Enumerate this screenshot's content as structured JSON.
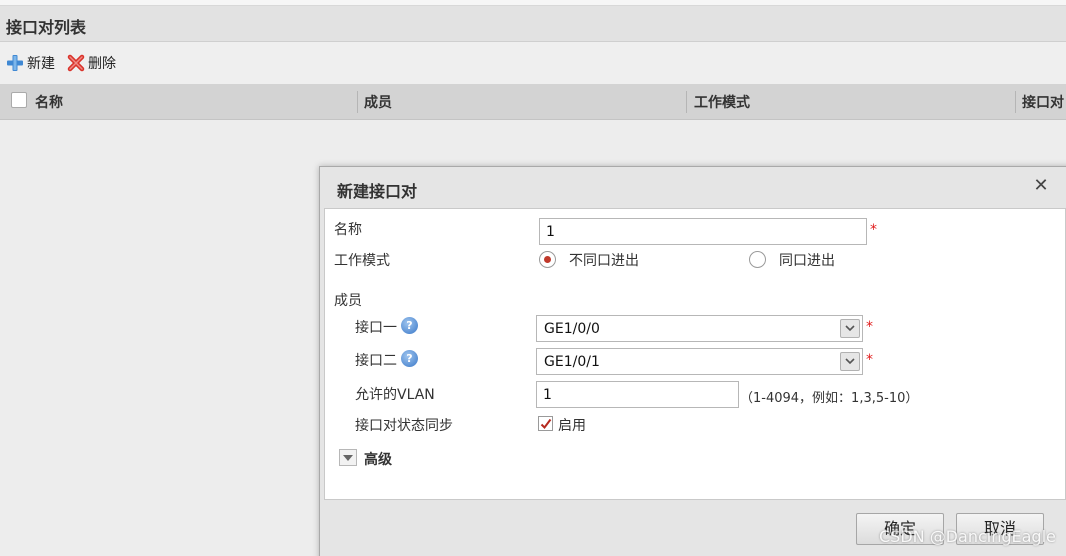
{
  "panel": {
    "title": "接口对列表"
  },
  "toolbar": {
    "new_label": "新建",
    "delete_label": "删除"
  },
  "grid": {
    "columns": [
      "名称",
      "成员",
      "工作模式",
      "接口对"
    ]
  },
  "dialog": {
    "title": "新建接口对",
    "close_glyph": "✕",
    "name": {
      "label": "名称",
      "value": "1",
      "required_mark": "*"
    },
    "work_mode": {
      "label": "工作模式",
      "options": [
        "不同口进出",
        "同口进出"
      ],
      "selected": "不同口进出"
    },
    "members": {
      "label": "成员",
      "iface1": {
        "label": "接口一",
        "value": "GE1/0/0",
        "required_mark": "*"
      },
      "iface2": {
        "label": "接口二",
        "value": "GE1/0/1",
        "required_mark": "*"
      },
      "vlan": {
        "label": "允许的VLAN",
        "value": "1",
        "hint": "（1-4094，例如：1,3,5-10）"
      },
      "sync": {
        "label": "接口对状态同步",
        "checkbox_label": "启用",
        "checked": true
      }
    },
    "advanced": {
      "label": "高级"
    },
    "buttons": {
      "ok": "确定",
      "cancel": "取消"
    }
  },
  "help_glyph": "?",
  "watermark": "CSDN @DancingEagle",
  "colors": {
    "required": "#e01a1a",
    "radio_dot": "#c0392b",
    "check_mark": "#b52a1f",
    "help_icon": "#3a78c8"
  }
}
